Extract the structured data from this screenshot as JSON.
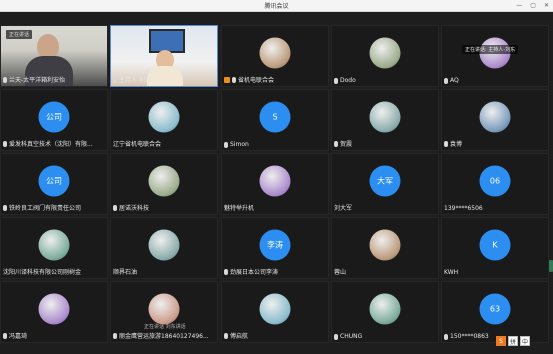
{
  "window": {
    "title": "腾讯会议"
  },
  "video_tag": "正在讲话",
  "notices": {
    "speaking": "正在讲话: 主持人-刘东",
    "tile_overlay": "正在讲话 刘东讲话"
  },
  "tiles": [
    {
      "label": "兰天-太平洋箱利安怡",
      "avatar": "",
      "avatar_type": "video",
      "row": 0,
      "col": 0,
      "mic": true
    },
    {
      "label": "主持人-刘东",
      "avatar": "",
      "avatar_type": "video",
      "row": 0,
      "col": 1,
      "mic": true,
      "active": true
    },
    {
      "label": "省机电联合会",
      "avatar": "",
      "avatar_type": "img",
      "row": 0,
      "col": 2,
      "mic": true,
      "host": true
    },
    {
      "label": "Dodo",
      "avatar": "",
      "avatar_type": "img",
      "row": 0,
      "col": 3,
      "mic": true
    },
    {
      "label": "AQ",
      "avatar": "",
      "avatar_type": "img",
      "row": 0,
      "col": 4,
      "mic": true
    },
    {
      "label": "爱发科真空技术（沈阳）有限...",
      "avatar": "公司",
      "avatar_type": "text",
      "row": 1,
      "col": 0,
      "mic": true
    },
    {
      "label": "辽宁省机电联合会",
      "avatar": "",
      "avatar_type": "img",
      "row": 1,
      "col": 1,
      "mic": false
    },
    {
      "label": "Simon",
      "avatar": "S",
      "avatar_type": "text",
      "row": 1,
      "col": 2,
      "mic": true
    },
    {
      "label": "贺震",
      "avatar": "",
      "avatar_type": "img",
      "row": 1,
      "col": 3,
      "mic": true
    },
    {
      "label": "袁博",
      "avatar": "",
      "avatar_type": "img",
      "row": 1,
      "col": 4,
      "mic": true
    },
    {
      "label": "铁岭良工阀门有限责任公司",
      "avatar": "公司",
      "avatar_type": "text",
      "row": 2,
      "col": 0,
      "mic": true
    },
    {
      "label": "居诺沃科技",
      "avatar": "",
      "avatar_type": "img",
      "row": 2,
      "col": 1,
      "mic": true
    },
    {
      "label": "魅特举升机",
      "avatar": "",
      "avatar_type": "img",
      "row": 2,
      "col": 2,
      "mic": false
    },
    {
      "label": "刘大军",
      "avatar": "大军",
      "avatar_type": "text",
      "row": 2,
      "col": 3,
      "mic": false
    },
    {
      "label": "139****6506",
      "avatar": "06",
      "avatar_type": "text",
      "row": 2,
      "col": 4,
      "mic": false
    },
    {
      "label": "沈阳川译科技有限公司刚树金",
      "avatar": "",
      "avatar_type": "img",
      "row": 3,
      "col": 0,
      "mic": false
    },
    {
      "label": "顺界石油",
      "avatar": "",
      "avatar_type": "img",
      "row": 3,
      "col": 1,
      "mic": false
    },
    {
      "label": "劲展日本公司李涛",
      "avatar": "李涛",
      "avatar_type": "text",
      "row": 3,
      "col": 2,
      "mic": true
    },
    {
      "label": "蓉山",
      "avatar": "",
      "avatar_type": "img",
      "row": 3,
      "col": 3,
      "mic": false
    },
    {
      "label": "KWH",
      "avatar": "K",
      "avatar_type": "text",
      "row": 3,
      "col": 4,
      "mic": false
    },
    {
      "label": "冯嘉琦",
      "avatar": "",
      "avatar_type": "img",
      "row": 4,
      "col": 0,
      "mic": true
    },
    {
      "label": "丽金鹰营运旅游18640127496...",
      "avatar": "",
      "avatar_type": "img",
      "row": 4,
      "col": 1,
      "mic": true
    },
    {
      "label": "傅启航",
      "avatar": "",
      "avatar_type": "img",
      "row": 4,
      "col": 2,
      "mic": true
    },
    {
      "label": "CHUNG",
      "avatar": "",
      "avatar_type": "img",
      "row": 4,
      "col": 3,
      "mic": true
    },
    {
      "label": "150****0863",
      "avatar": "63",
      "avatar_type": "text",
      "row": 4,
      "col": 4,
      "mic": true
    }
  ],
  "bottom_bar": {
    "btn1": "S",
    "btn2": "拼",
    "btn3": "中"
  }
}
